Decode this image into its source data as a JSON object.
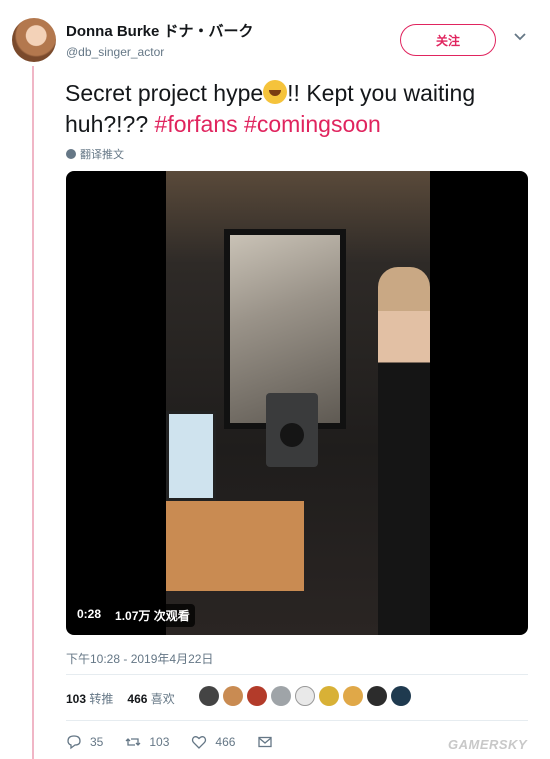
{
  "user": {
    "display_name": "Donna Burke ドナ・バーク",
    "handle": "@db_singer_actor",
    "follow_label": "关注"
  },
  "tweet": {
    "text_before_emoji": "Secret project hype",
    "text_after_emoji": "!! Kept you waiting huh?!?? ",
    "hashtag_1": "#forfans",
    "hashtag_2": "#comingsoon",
    "emoji_icon": "rolling-on-floor-laughing-icon",
    "translate_label": "翻译推文"
  },
  "video": {
    "duration": "0:28",
    "views": "1.07万 次观看"
  },
  "meta": {
    "timestamp": "下午10:28 - 2019年4月22日"
  },
  "stats": {
    "retweets_count": "103",
    "retweets_label": "转推",
    "likes_count": "466",
    "likes_label": "喜欢"
  },
  "likers": [
    "avatar-1",
    "avatar-2",
    "avatar-3",
    "avatar-4",
    "avatar-5",
    "avatar-6",
    "avatar-7",
    "avatar-8",
    "avatar-9",
    "avatar-10"
  ],
  "actions": {
    "reply_count": "35",
    "retweet_count": "103",
    "like_count": "466"
  },
  "watermark": "GAMERSKY",
  "colors": {
    "accent": "#e0245e",
    "thread_line": "#f0b6c6",
    "secondary_text": "#657786"
  }
}
